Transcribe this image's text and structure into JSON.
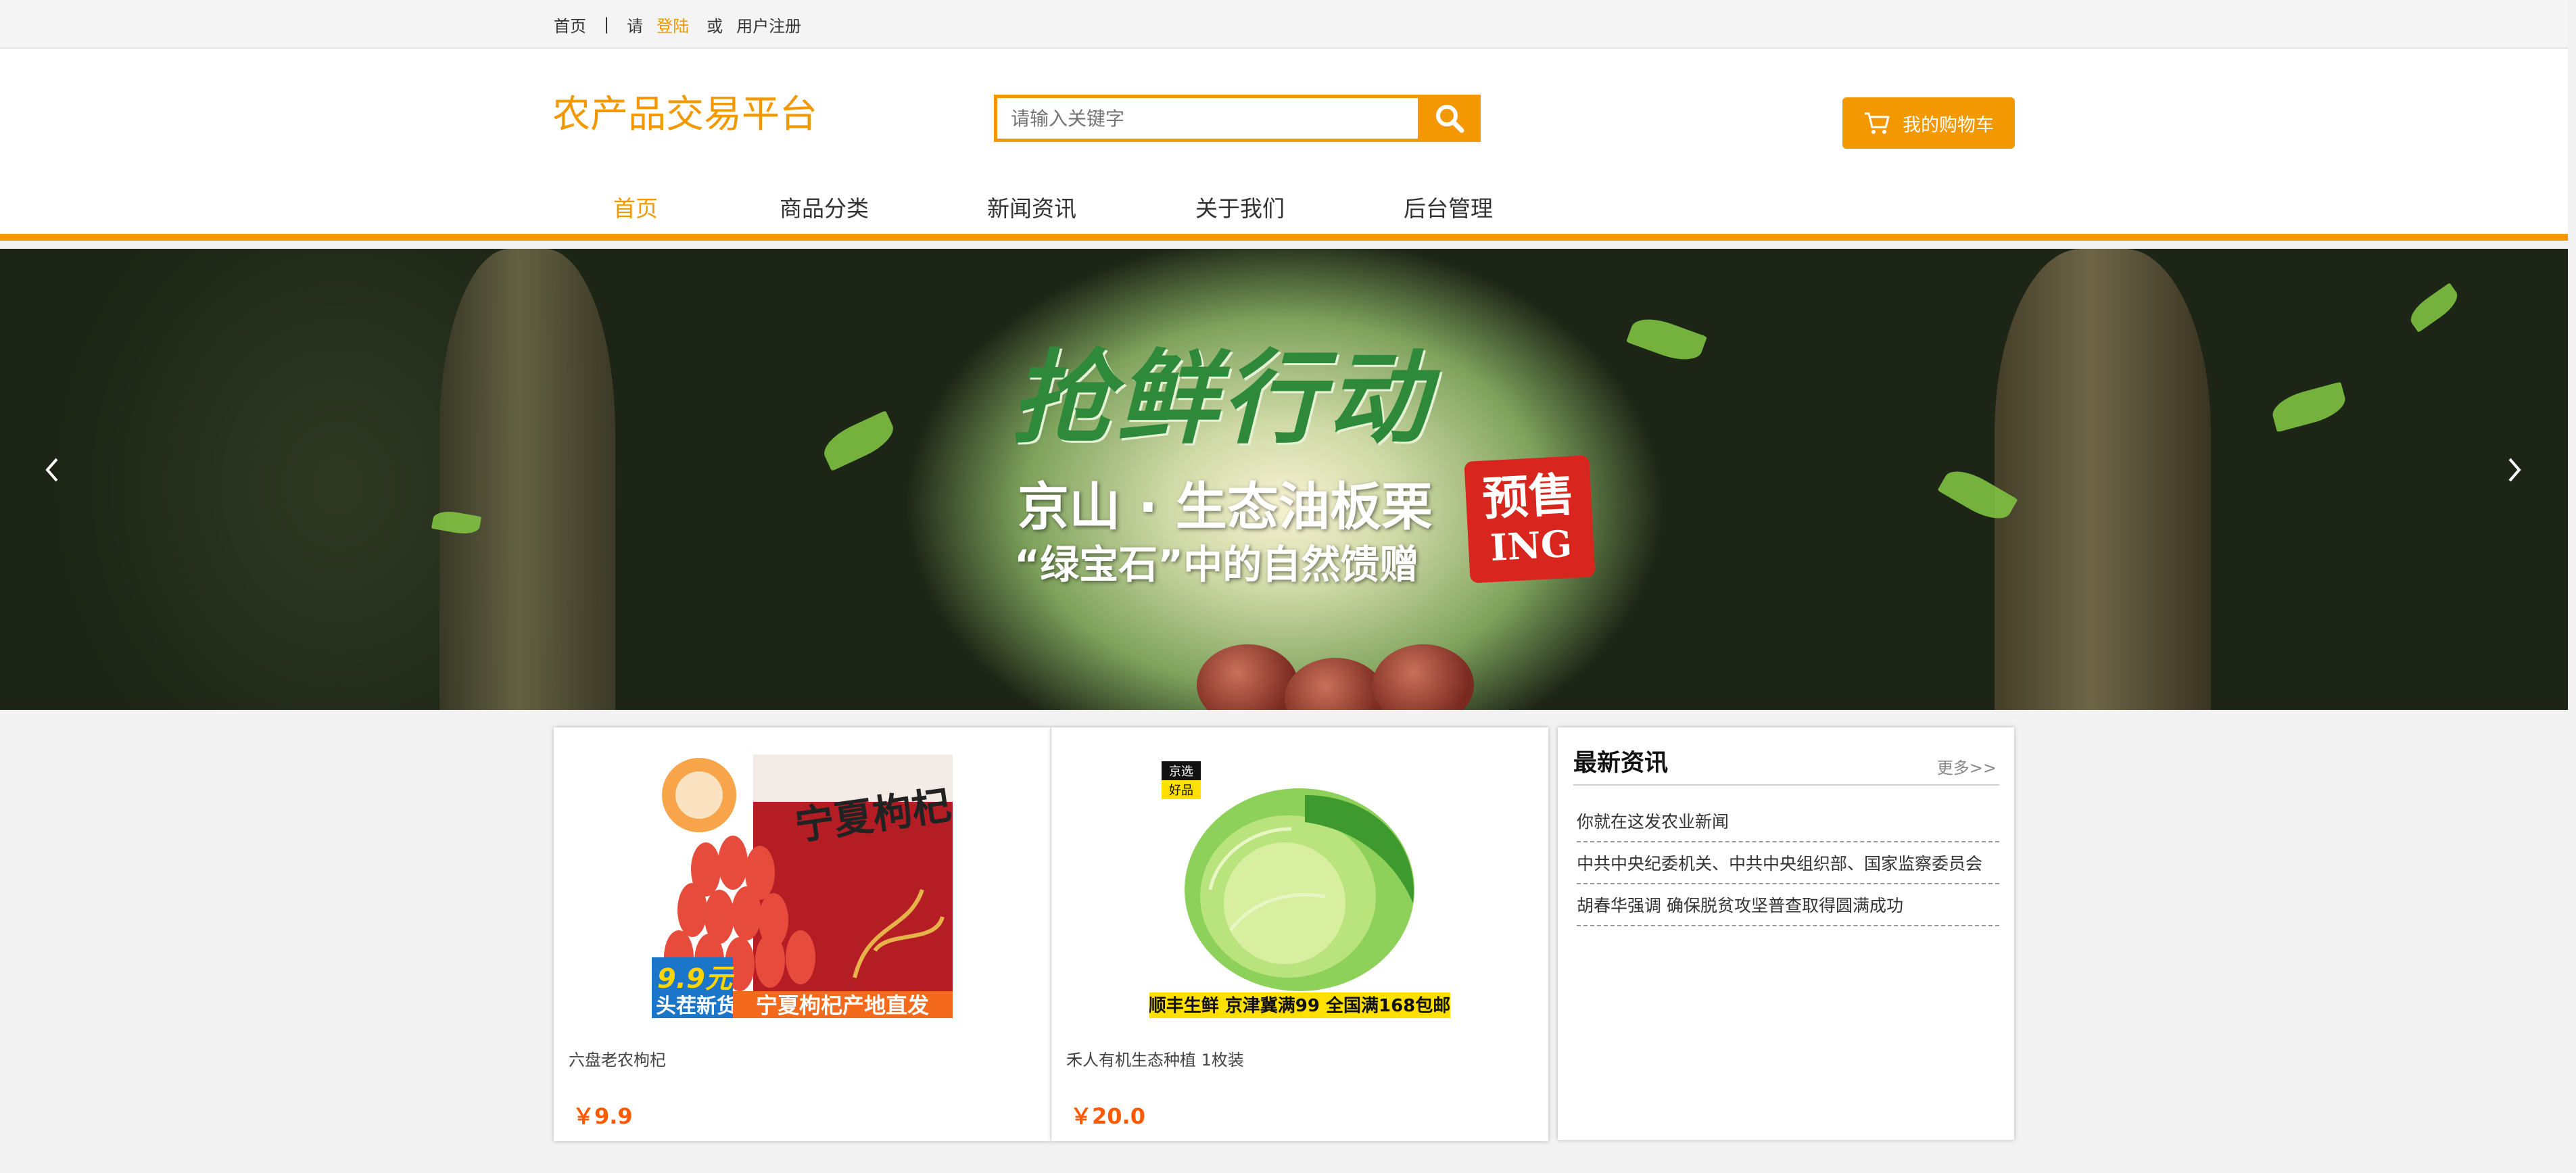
{
  "topbar": {
    "home": "首页",
    "sep": "|",
    "prefix": "请",
    "login": "登陆",
    "or": "或",
    "register": "用户注册"
  },
  "header": {
    "logo": "农产品交易平台",
    "search_placeholder": "请输入关键字",
    "search_icon": "search-icon",
    "cart_label": "我的购物车",
    "cart_icon": "cart-icon"
  },
  "nav": {
    "items": [
      {
        "label": "首页",
        "active": true
      },
      {
        "label": "商品分类",
        "active": false
      },
      {
        "label": "新闻资讯",
        "active": false
      },
      {
        "label": "关于我们",
        "active": false
      },
      {
        "label": "后台管理",
        "active": false
      }
    ]
  },
  "banner": {
    "title": "抢鲜行动",
    "subtitle1": "京山 · 生态油板栗",
    "subtitle2": "“绿宝石”中的自然馈赠",
    "stamp_line1": "预售",
    "stamp_line2": "ING",
    "slide_count": 2,
    "active_slide": 2,
    "prev_icon": "chevron-left-icon",
    "next_icon": "chevron-right-icon"
  },
  "products": [
    {
      "name": "六盘老农枸杞",
      "price": "￥9.9",
      "image_badge": "9.9元",
      "image_badge2": "头茬新货",
      "image_banner": "宁夏枸杞产地直发",
      "image_pack": "宁夏枸杞"
    },
    {
      "name": "禾人有机生态种植 1枚装",
      "price": "￥20.0",
      "image_tag1": "京选",
      "image_tag2": "好品",
      "image_banner": "顺丰生鲜 京津冀满99 全国满168包邮"
    }
  ],
  "news": {
    "title": "最新资讯",
    "more": "更多>>",
    "items": [
      "你就在这发农业新闻",
      "中共中央纪委机关、中共中央组织部、国家监察委员会",
      "胡春华强调 确保脱贫攻坚普查取得圆满成功"
    ]
  },
  "colors": {
    "accent": "#f39800",
    "price": "#ff5a00"
  }
}
